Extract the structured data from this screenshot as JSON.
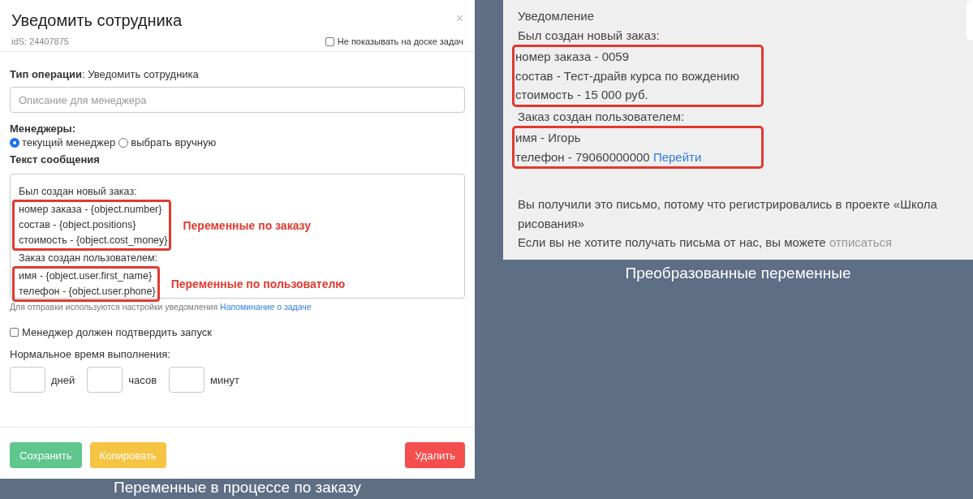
{
  "dialog": {
    "title": "Уведомить сотрудника",
    "close": "×",
    "ids": "idS: 24407875",
    "hide_on_board": {
      "label": "Не показывать на доске задач",
      "checked": false
    },
    "operation_label": "Тип операции",
    "operation_value": ": Уведомить сотрудника",
    "description": {
      "placeholder": "Описание для менеджера"
    },
    "managers_label": "Менеджеры:",
    "managers": [
      {
        "label": "текущий менеджер",
        "selected": true
      },
      {
        "label": "выбрать вручную",
        "selected": false
      }
    ],
    "message_label": "Текст сообщения",
    "message": [
      {
        "kind": "plain",
        "lines": [
          "Был создан новый заказ:"
        ]
      },
      {
        "kind": "highlight",
        "lines": [
          "номер заказа - {object.number}",
          "состав - {object.positions}",
          "стоимость - {object.cost_money}"
        ],
        "note": "Переменные по заказу"
      },
      {
        "kind": "plain",
        "lines": [
          "Заказ создан пользователем:"
        ]
      },
      {
        "kind": "highlight",
        "lines": [
          "имя - {object.user.first_name}",
          "телефон - {object.user.phone}"
        ],
        "note": "Переменные по пользователю"
      }
    ],
    "hint": "Для отправки используются настройки уведомления",
    "hint_link": "Напоминание о задаче",
    "confirm": {
      "label": "Менеджер должен подтвердить запуск",
      "checked": false
    },
    "duration_label": "Нормальное время выполнения:",
    "duration": [
      {
        "unit": "дней"
      },
      {
        "unit": "часов"
      },
      {
        "unit": "минут"
      }
    ],
    "buttons": [
      {
        "label": "Сохранить",
        "kind": "success"
      },
      {
        "label": "Копировать",
        "kind": "warning"
      },
      {
        "label": "Удалить",
        "kind": "danger"
      }
    ]
  },
  "left_caption": "Переменные в процессе по заказу",
  "email": {
    "groups": [
      {
        "kind": "plain",
        "lines": [
          {
            "text": "Уведомление"
          },
          {
            "text": "Был создан новый заказ:"
          }
        ]
      },
      {
        "kind": "highlight",
        "lines": [
          {
            "text": "номер заказа - 0059"
          },
          {
            "text": "состав - Тест-драйв курса по вождению"
          },
          {
            "text": "стоимость - 15 000 руб."
          }
        ]
      },
      {
        "kind": "plain",
        "lines": [
          {
            "text": "Заказ создан пользователем:"
          }
        ]
      },
      {
        "kind": "highlight",
        "lines": [
          {
            "text": "имя - Игорь"
          },
          {
            "text": "телефон - 79060000000",
            "link": "Перейти"
          }
        ]
      }
    ],
    "footer": "Вы получили это письмо, потому что регистрировались в проекте «Школа рисования»",
    "unsubscribe_text": "Если вы не хотите получать письма от нас, вы можете",
    "unsubscribe_link": "отписаться"
  },
  "right_caption": "Преобразованные переменные"
}
